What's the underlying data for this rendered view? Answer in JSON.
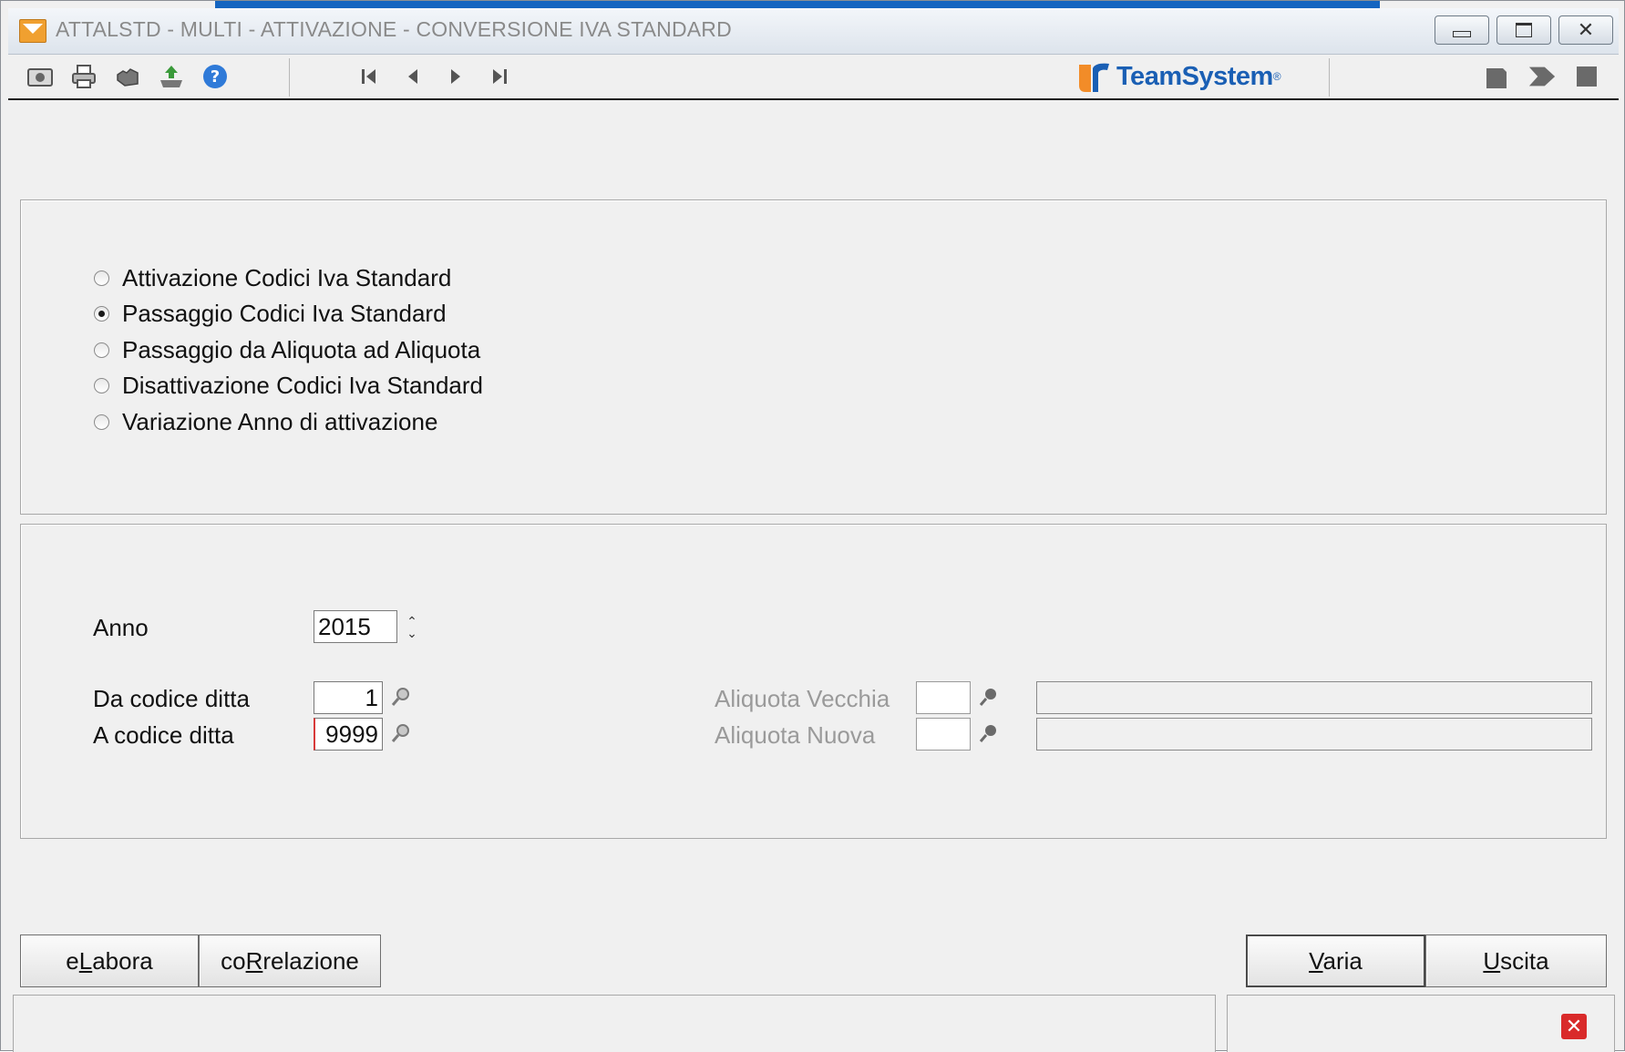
{
  "window": {
    "title": "ATTALSTD  - MULTI -  ATTIVAZIONE - CONVERSIONE IVA STANDARD",
    "controls": [
      "minimize-icon",
      "restore-icon",
      "close-icon"
    ]
  },
  "toolbar": {
    "left_icons": [
      "camera-icon",
      "print-icon",
      "hand-icon",
      "export-icon",
      "help-icon"
    ],
    "nav_icons": [
      "first-record-icon",
      "previous-record-icon",
      "next-record-icon",
      "last-record-icon"
    ],
    "right_icons": [
      "page-icon",
      "arrow-right-icon",
      "stop-icon"
    ],
    "logo_text": "TeamSystem",
    "logo_reg": "®"
  },
  "options": {
    "items": [
      {
        "label": "Attivazione Codici Iva Standard",
        "selected": false
      },
      {
        "label": "Passaggio Codici Iva Standard",
        "selected": true
      },
      {
        "label": "Passaggio da Aliquota ad Aliquota",
        "selected": false
      },
      {
        "label": "Disattivazione Codici Iva Standard",
        "selected": false
      },
      {
        "label": "Variazione Anno di attivazione",
        "selected": false
      }
    ]
  },
  "form": {
    "anno_label": "Anno",
    "anno_value": "2015",
    "da_codice_label": "Da codice ditta",
    "da_codice_value": "1",
    "a_codice_label": "A codice ditta",
    "a_codice_value": "9999",
    "aliquota_vecchia_label": "Aliquota Vecchia",
    "aliquota_vecchia_value": "",
    "aliquota_nuova_label": "Aliquota Nuova",
    "aliquota_nuova_value": ""
  },
  "buttons": {
    "elabora_pre": "e",
    "elabora_key": "L",
    "elabora_post": "abora",
    "correlazione_pre": "co",
    "correlazione_key": "R",
    "correlazione_post": "relazione",
    "varia_key": "V",
    "varia_post": "aria",
    "uscita_key": "U",
    "uscita_post": "scita"
  },
  "colors": {
    "accent": "#1565c0",
    "logo": "#1a5fb4",
    "error_icon": "#d92a2a",
    "disabled_text": "#9a9a9a"
  }
}
